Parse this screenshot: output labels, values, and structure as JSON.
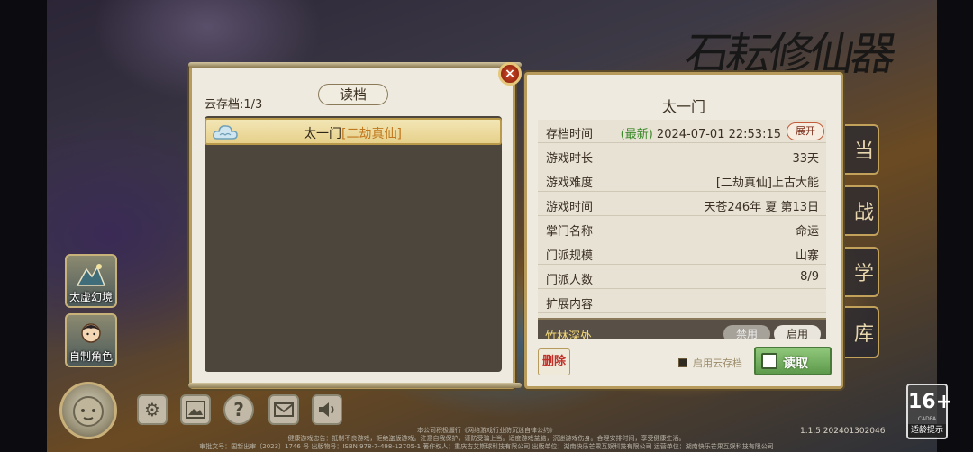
{
  "background": {
    "title_art": "石耘修仙器",
    "right_menu": [
      "当",
      "战",
      "学",
      "库"
    ]
  },
  "left_buttons": [
    {
      "label": "太虚幻境",
      "icon": "mountain-icon"
    },
    {
      "label": "自制角色",
      "icon": "character-icon"
    }
  ],
  "toolbar": {
    "icons": [
      "avatar-icon",
      "settings-icon",
      "gallery-icon",
      "help-icon",
      "mail-icon",
      "sound-icon"
    ]
  },
  "load_dialog": {
    "title": "读档",
    "cloud_count": "云存档:1/3",
    "close_label": "×",
    "saves": [
      {
        "name": "太一门",
        "rank": "[二劫真仙]",
        "icon": "cloud-icon"
      }
    ]
  },
  "detail": {
    "title": "太一门",
    "rows": [
      {
        "key": "存档时间",
        "tag": "(最新)",
        "value": "2024-07-01 22:53:15"
      },
      {
        "key": "游戏时长",
        "value": "33天"
      },
      {
        "key": "游戏难度",
        "value": "[二劫真仙]上古大能"
      },
      {
        "key": "游戏时间",
        "value": "天苍246年 夏 第13日"
      },
      {
        "key": "掌门名称",
        "value": "命运"
      },
      {
        "key": "门派规模",
        "value": "山寨"
      },
      {
        "key": "门派人数",
        "value": "8/9"
      },
      {
        "key": "扩展内容",
        "value": ""
      }
    ],
    "expand_label": "展开",
    "extension": {
      "name": "竹林深处",
      "off_label": "禁用",
      "on_label": "启用"
    },
    "delete_label": "删除",
    "cloud_option_label": "启用云存档",
    "load_label": "读取"
  },
  "footer": {
    "line1": "本公司积极履行《网络游戏行业防沉迷自律公约》",
    "line2": "健康游戏忠告：抵制不良游戏，拒绝盗版游戏。注意自我保护，谨防受骗上当。适度游戏益脑，沉迷游戏伤身。合理安排时间，享受健康生活。",
    "line3": "审批文号：国新出审〔2023〕1746 号 出版物号：ISBN 978-7-498-12705-1 著作权人：重庆吉艾斯球科技有限公司 出版单位：湖南快乐芒果互娱科技有限公司 运营单位：湖南快乐芒果互娱科技有限公司",
    "version": "1.1.5 202401302046",
    "age": "16+",
    "age_sub": "CADPA",
    "age_tip": "适龄提示"
  }
}
